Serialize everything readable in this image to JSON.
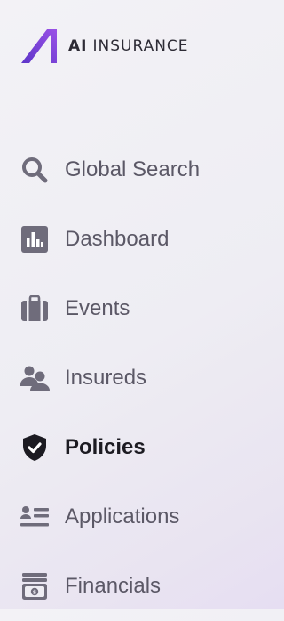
{
  "brand": {
    "logo_icon": "ai-logo-icon",
    "name_part1": "AI",
    "name_part2": "INSURANCE",
    "accent_color": "#7a3fd1"
  },
  "nav": {
    "items": [
      {
        "id": "global-search",
        "label": "Global Search",
        "icon": "search-icon",
        "active": false
      },
      {
        "id": "dashboard",
        "label": "Dashboard",
        "icon": "bar-chart-icon",
        "active": false
      },
      {
        "id": "events",
        "label": "Events",
        "icon": "briefcase-icon",
        "active": false
      },
      {
        "id": "insureds",
        "label": "Insureds",
        "icon": "users-icon",
        "active": false
      },
      {
        "id": "policies",
        "label": "Policies",
        "icon": "shield-check-icon",
        "active": true
      },
      {
        "id": "applications",
        "label": "Applications",
        "icon": "list-user-icon",
        "active": false
      },
      {
        "id": "financials",
        "label": "Financials",
        "icon": "money-stack-icon",
        "active": false
      }
    ],
    "icon_color": "#6f6c7b",
    "active_icon_color": "#1c1b22"
  }
}
